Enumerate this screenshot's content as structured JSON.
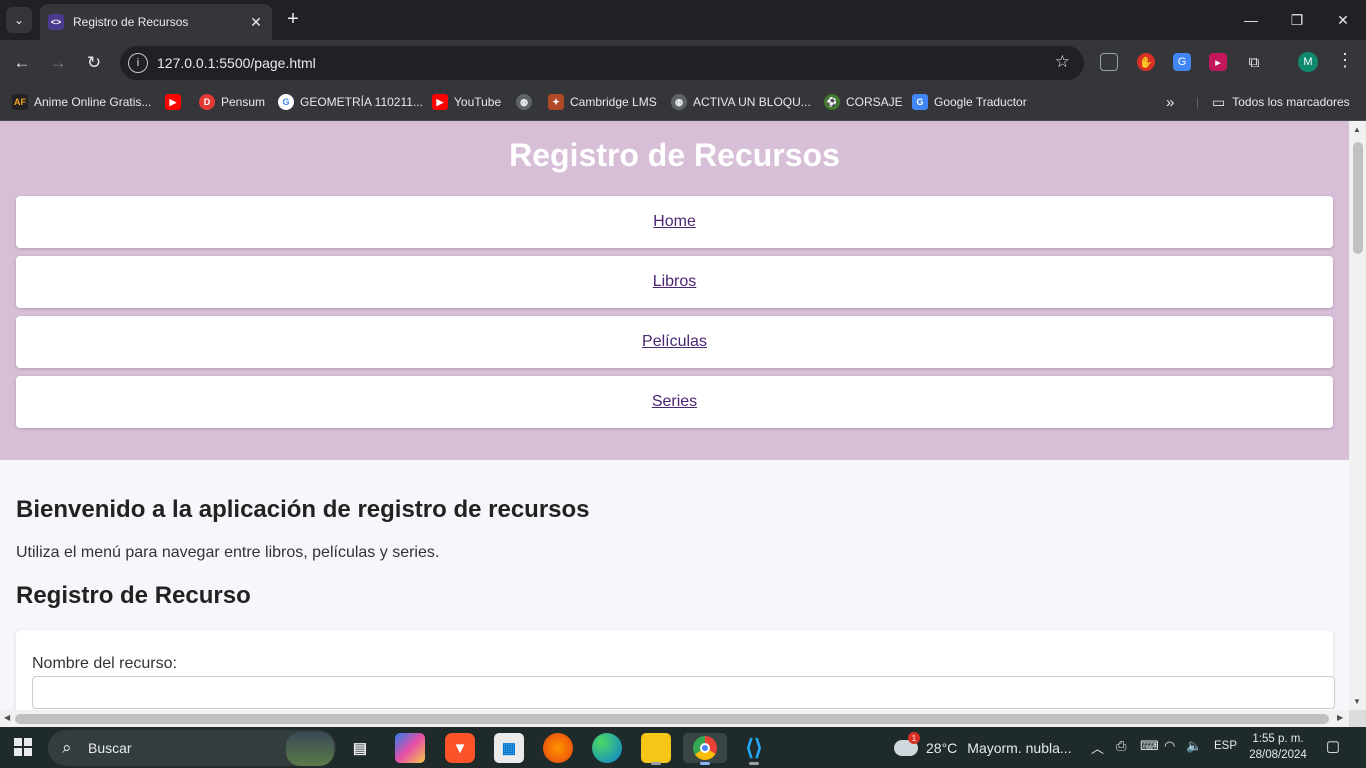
{
  "browser": {
    "tab_title": "Registro de Recursos",
    "url": "127.0.0.1:5500/page.html",
    "profile_initial": "M",
    "bookmarks": [
      {
        "label": "Anime Online Gratis...",
        "icon": "af-icon",
        "icon_text": "AF",
        "color": "#222222"
      },
      {
        "label": "",
        "icon": "youtube-icon",
        "icon_text": "▶",
        "color": "#ff0000"
      },
      {
        "label": "Pensum",
        "icon": "pensum-icon",
        "icon_text": "D",
        "color": "#e53935"
      },
      {
        "label": "GEOMETRÍA 110211...",
        "icon": "google-icon",
        "icon_text": "G",
        "color": "#ffffff"
      },
      {
        "label": "YouTube",
        "icon": "youtube-icon",
        "icon_text": "▶",
        "color": "#ff0000"
      },
      {
        "label": "",
        "icon": "globe-icon",
        "icon_text": "◍",
        "color": "#5f6368"
      },
      {
        "label": "Cambridge LMS",
        "icon": "cambridge-icon",
        "icon_text": "✦",
        "color": "#b24a2a"
      },
      {
        "label": "ACTIVA UN BLOQU...",
        "icon": "globe-icon",
        "icon_text": "◍",
        "color": "#5f6368"
      },
      {
        "label": "CORSAJE",
        "icon": "corsaje-icon",
        "icon_text": "⚽",
        "color": "#3d7a2a"
      },
      {
        "label": "Google Traductor",
        "icon": "translate-icon",
        "icon_text": "G",
        "color": "#4285f4"
      }
    ],
    "all_bookmarks": "Todos los marcadores"
  },
  "page": {
    "header_title": "Registro de Recursos",
    "nav": [
      "Home",
      "Libros",
      "Películas",
      "Series"
    ],
    "welcome_title": "Bienvenido a la aplicación de registro de recursos",
    "welcome_text": "Utiliza el menú para navegar entre libros, películas y series.",
    "form_title": "Registro de Recurso",
    "field_label": "Nombre del recurso:",
    "field_value": ""
  },
  "taskbar": {
    "search_placeholder": "Buscar",
    "weather_temp": "28°C",
    "weather_text": "Mayorm. nubla...",
    "weather_badge": "1",
    "language": "ESP",
    "time": "1:55 p. m.",
    "date": "28/08/2024"
  },
  "colors": {
    "header_bg": "#d8bfd8",
    "nav_link": "#4b2673",
    "page_bg": "#f6f7fb"
  }
}
